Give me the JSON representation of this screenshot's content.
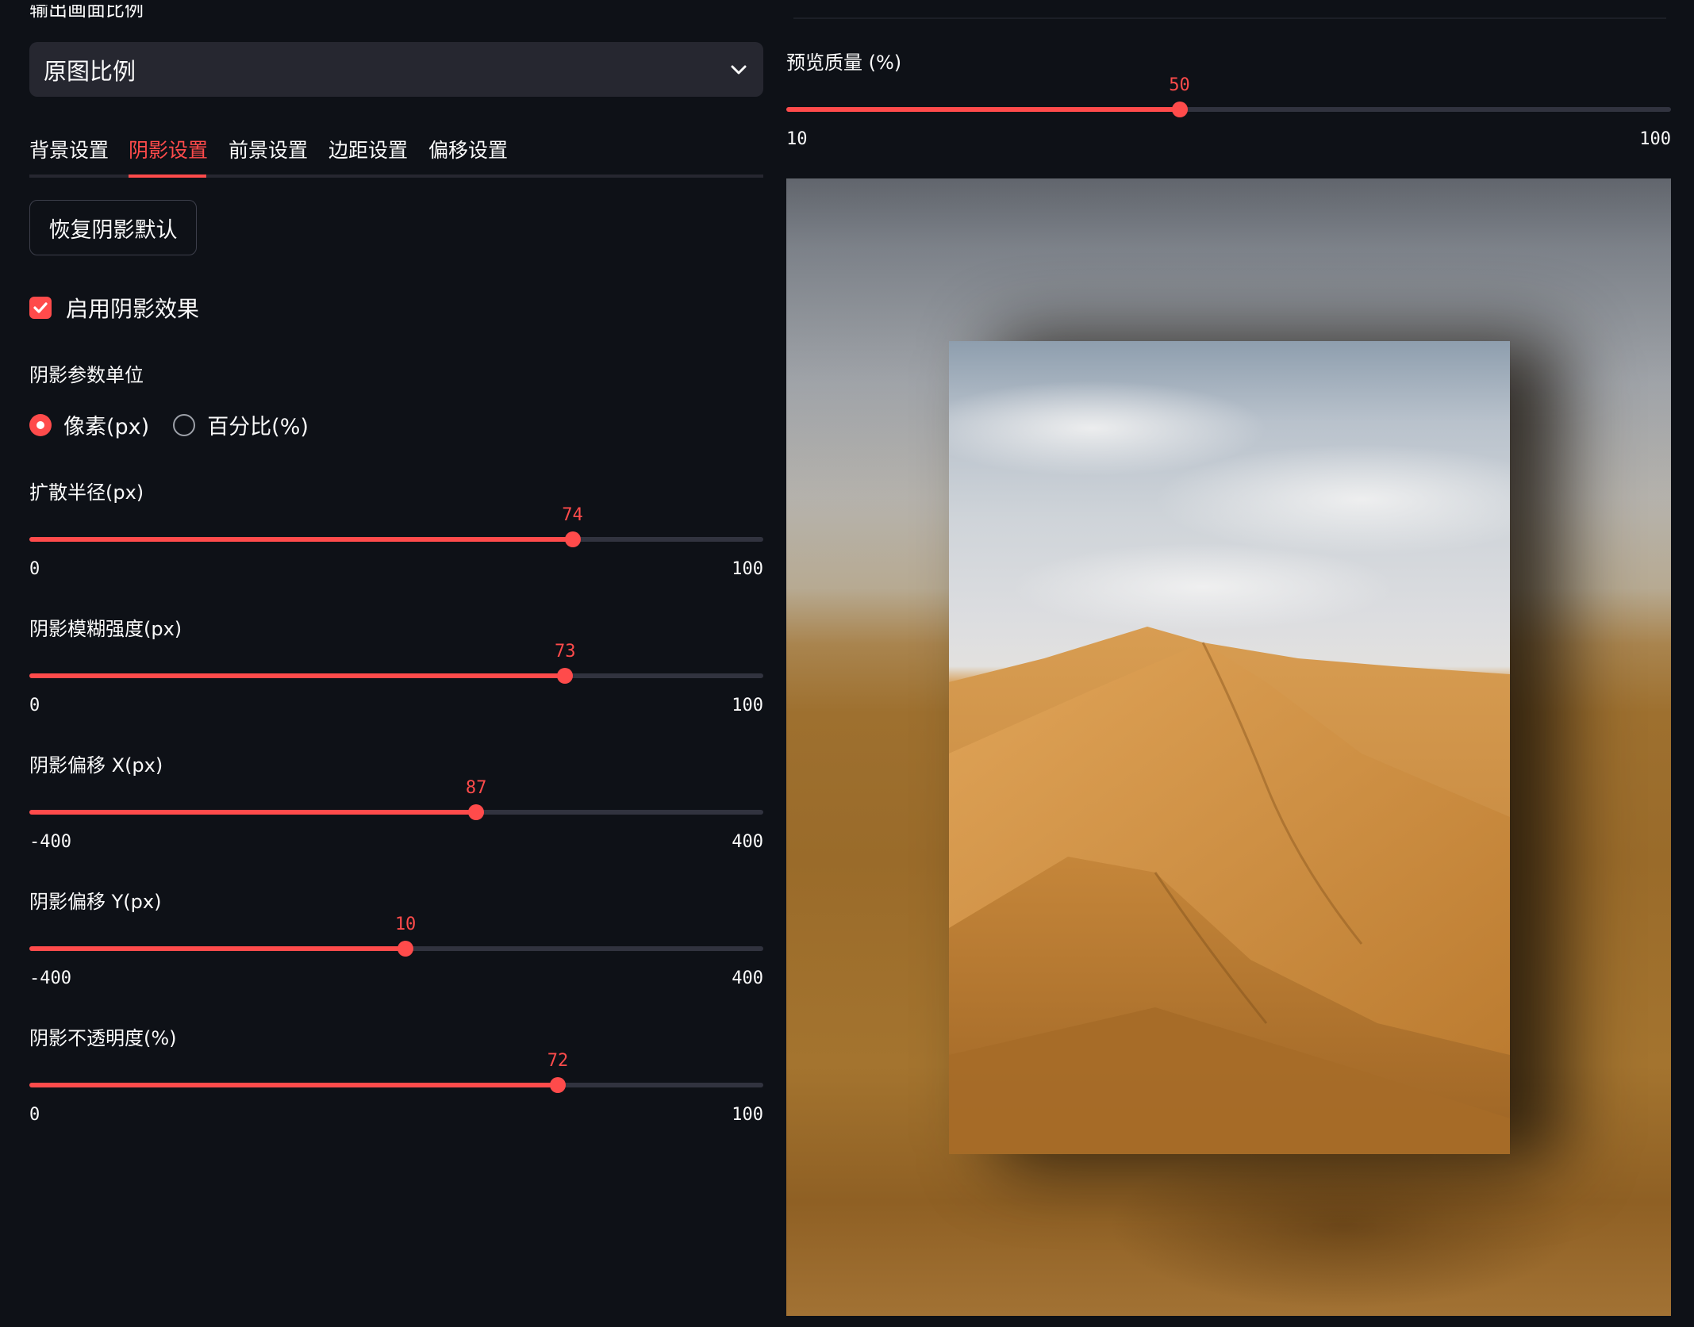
{
  "aspect": {
    "label": "输出画面比例",
    "selected": "原图比例"
  },
  "tabs": [
    {
      "label": "背景设置",
      "active": false
    },
    {
      "label": "阴影设置",
      "active": true
    },
    {
      "label": "前景设置",
      "active": false
    },
    {
      "label": "边距设置",
      "active": false
    },
    {
      "label": "偏移设置",
      "active": false
    }
  ],
  "reset_button": "恢复阴影默认",
  "enable_shadow": {
    "label": "启用阴影效果",
    "checked": true
  },
  "unit": {
    "label": "阴影参数单位",
    "options": [
      {
        "label": "像素(px)",
        "selected": true
      },
      {
        "label": "百分比(%)",
        "selected": false
      }
    ]
  },
  "sliders": [
    {
      "label": "扩散半径(px)",
      "value": 74,
      "min": 0,
      "max": 100,
      "value_text": "74",
      "min_text": "0",
      "max_text": "100"
    },
    {
      "label": "阴影模糊强度(px)",
      "value": 73,
      "min": 0,
      "max": 100,
      "value_text": "73",
      "min_text": "0",
      "max_text": "100"
    },
    {
      "label": "阴影偏移 X(px)",
      "value": 87,
      "min": -400,
      "max": 400,
      "value_text": "87",
      "min_text": "-400",
      "max_text": "400"
    },
    {
      "label": "阴影偏移 Y(px)",
      "value": 10,
      "min": -400,
      "max": 400,
      "value_text": "10",
      "min_text": "-400",
      "max_text": "400"
    },
    {
      "label": "阴影不透明度(%)",
      "value": 72,
      "min": 0,
      "max": 100,
      "value_text": "72",
      "min_text": "0",
      "max_text": "100"
    }
  ],
  "preview_quality": {
    "label": "预览质量 (%)",
    "value": 50,
    "min": 10,
    "max": 100,
    "value_text": "50",
    "min_text": "10",
    "max_text": "100"
  },
  "colors": {
    "accent": "#ff4b4b",
    "background": "#0e1117",
    "surface": "#262730",
    "track": "#31333f"
  },
  "icons": {
    "dropdown": "chevron-down-icon",
    "checkbox": "check-icon"
  }
}
